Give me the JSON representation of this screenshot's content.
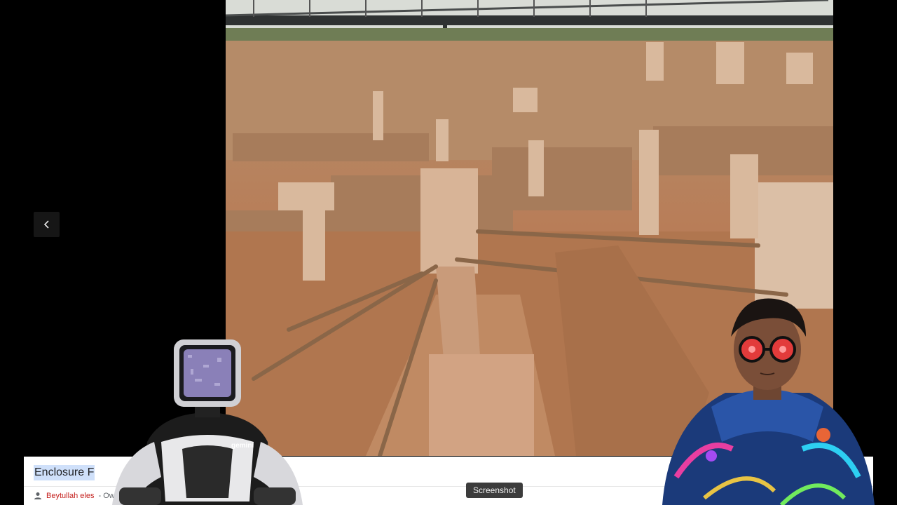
{
  "viewer": {
    "prev_icon": "chevron-left-icon"
  },
  "caption": {
    "title": "Enclosure F",
    "author": "Beytullah eles",
    "author_suffix": "- Ow",
    "user_icon": "person-icon"
  },
  "tooltip": {
    "text": "Screenshot"
  },
  "overlay": {
    "robot_chest_text": "gemini"
  },
  "colors": {
    "background": "#000000",
    "caption_bg": "#ffffff",
    "title_highlight": "#cfe0fa",
    "credit_link": "#c5221f",
    "tooltip_bg": "#3c3c3c"
  }
}
